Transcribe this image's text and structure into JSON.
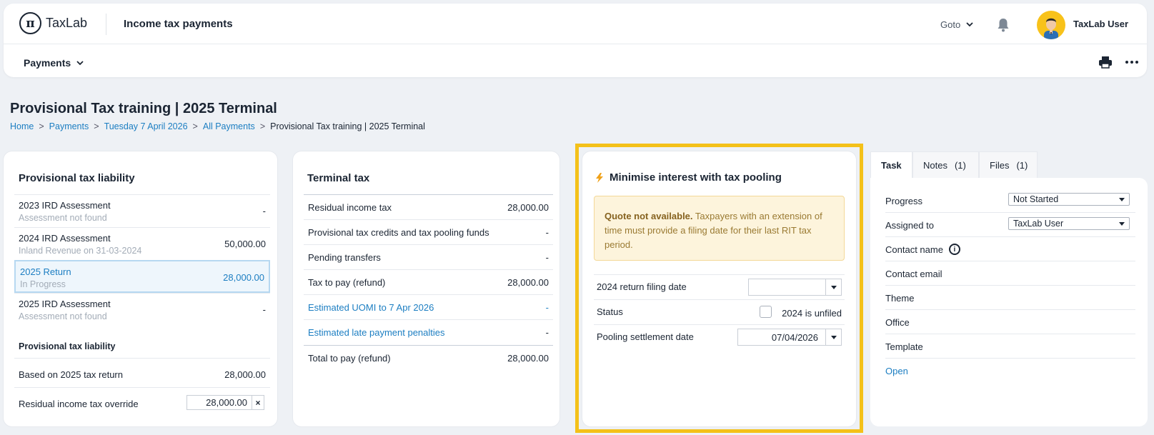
{
  "app": {
    "logo_symbol": "π",
    "logo_text": "TaxLab",
    "title": "Income tax payments",
    "goto_label": "Goto",
    "user_name": "TaxLab User"
  },
  "subnav": {
    "payments_label": "Payments"
  },
  "page": {
    "title": "Provisional Tax training | 2025 Terminal",
    "breadcrumb": [
      "Home",
      "Payments",
      "Tuesday 7 April 2026",
      "All Payments",
      "Provisional Tax training | 2025 Terminal"
    ]
  },
  "liability": {
    "title": "Provisional tax liability",
    "rows": [
      {
        "label": "2023 IRD Assessment",
        "sub": "Assessment not found",
        "value": "-"
      },
      {
        "label": "2024 IRD Assessment",
        "sub": "Inland Revenue on 31-03-2024",
        "value": "50,000.00"
      },
      {
        "label": "2025 Return",
        "sub": "In Progress",
        "value": "28,000.00"
      },
      {
        "label": "2025 IRD Assessment",
        "sub": "Assessment not found",
        "value": "-"
      }
    ],
    "subheading": "Provisional tax liability",
    "based_label": "Based on 2025 tax return",
    "based_value": "28,000.00",
    "override_label": "Residual income tax override",
    "override_value": "28,000.00",
    "override_clear": "×"
  },
  "terminal": {
    "title": "Terminal tax",
    "rows": [
      {
        "label": "Residual income tax",
        "value": "28,000.00"
      },
      {
        "label": "Provisional tax credits and tax pooling funds",
        "value": "-"
      },
      {
        "label": "Pending transfers",
        "value": "-"
      },
      {
        "label": "Tax to pay (refund)",
        "value": "28,000.00"
      },
      {
        "label": "Estimated UOMI to 7 Apr 2026",
        "value": "-"
      },
      {
        "label": "Estimated late payment penalties",
        "value": "-"
      }
    ],
    "total_label": "Total to pay (refund)",
    "total_value": "28,000.00"
  },
  "pooling": {
    "title": "Minimise interest with tax pooling",
    "quote_bold": "Quote not available.",
    "quote_text": " Taxpayers with an extension of time must provide a filing date for their last RIT tax period.",
    "filing_label": "2024 return filing date",
    "filing_value": "",
    "status_label": "Status",
    "unfiled_label": "2024 is unfiled",
    "settlement_label": "Pooling settlement date",
    "settlement_value": "07/04/2026"
  },
  "task": {
    "tabs": [
      {
        "label": "Task",
        "count": ""
      },
      {
        "label": "Notes",
        "count": "(1)"
      },
      {
        "label": "Files",
        "count": "(1)"
      }
    ],
    "progress_label": "Progress",
    "progress_value": "Not Started",
    "assigned_label": "Assigned to",
    "assigned_value": "TaxLab User",
    "contact_name_label": "Contact name",
    "contact_email_label": "Contact email",
    "theme_label": "Theme",
    "office_label": "Office",
    "template_label": "Template",
    "open_label": "Open"
  },
  "colors": {
    "accent": "#1c7ec2",
    "highlight": "#f4c119",
    "warning_bg": "#fdf4dc"
  }
}
